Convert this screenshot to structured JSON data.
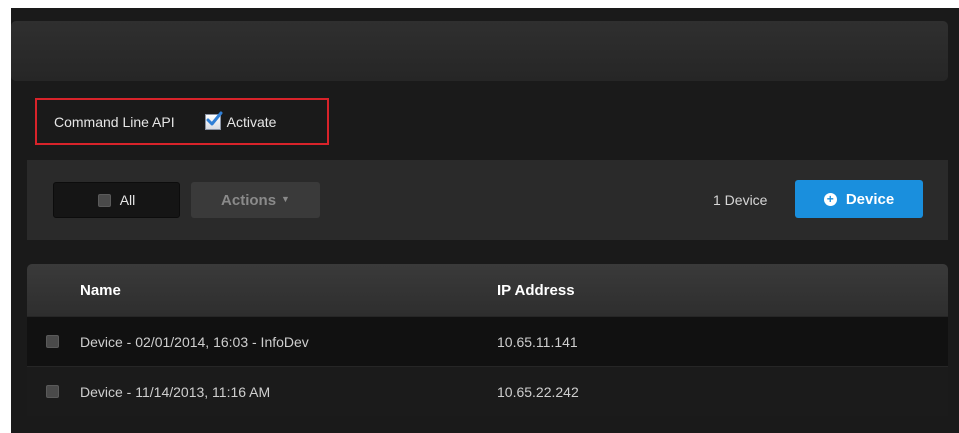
{
  "api": {
    "label": "Command Line API",
    "activate_label": "Activate",
    "activate_checked": true
  },
  "toolbar": {
    "all_label": "All",
    "actions_label": "Actions",
    "device_count": "1 Device",
    "add_device_label": "Device"
  },
  "table": {
    "columns": [
      "Name",
      "IP Address"
    ],
    "rows": [
      {
        "name": "Device - 02/01/2014, 16:03 - InfoDev",
        "ip": "10.65.11.141"
      },
      {
        "name": "Device - 11/14/2013, 11:16 AM",
        "ip": "10.65.22.242"
      }
    ]
  },
  "colors": {
    "highlight_border": "#d8232a",
    "primary_button": "#1a8fdd",
    "background": "#1a1a1a"
  },
  "icons": [
    "checkbox-checked-icon",
    "checkbox-icon",
    "caret-down-icon",
    "plus-circle-icon"
  ]
}
